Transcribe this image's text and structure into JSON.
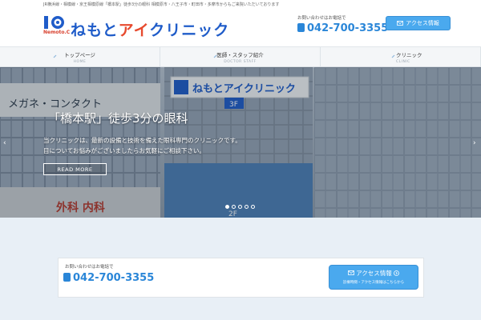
{
  "header": {
    "tagline": "JR横浜線・相模線・京王相模原線「橋本駅」徒歩3分の眼科 相模原市・八王子市・町田市・多摩市からもご来院いただいております",
    "logo_sub": "Nemoto.C",
    "logo_name_1": "ねもと",
    "logo_name_2": "アイ",
    "logo_name_3": "クリニック",
    "contact_label": "お問い合わせはお電話で",
    "phone": "042-700-3355",
    "access_button": "アクセス情報"
  },
  "nav": {
    "items": [
      {
        "label": "トップページ",
        "sub": "HOME"
      },
      {
        "label": "医師・スタッフ紹介",
        "sub": "DOCTOR STAFF"
      },
      {
        "label": "クリニック",
        "sub": "CLINIC"
      }
    ]
  },
  "hero": {
    "title": "「橋本駅」徒歩3分の眼科",
    "text_line1": "当クリニックは、最新の設備と技術を備えた眼科専門のクリニックです。",
    "text_line2": "目についてお悩みがございましたらお気軽にご相談下さい。",
    "read_more": "READ MORE",
    "sign_text": "ねもとアイクリニック",
    "sign_floor": "3F",
    "left_sign": "メガネ・コンタクト",
    "lower_sign": "外科 内科",
    "floor_2": "2F",
    "slide_count": 5,
    "active_slide": 1
  },
  "contact": {
    "label": "お問い合わせはお電話で",
    "phone": "042-700-3355",
    "button_label": "アクセス情報",
    "button_sub": "診療時間・アクセス情報はこちらから"
  },
  "colors": {
    "brand_blue": "#1f5cc9",
    "accent_red": "#e74a2e",
    "button_blue": "#4aa9ee",
    "phone_blue": "#2a86d8"
  }
}
